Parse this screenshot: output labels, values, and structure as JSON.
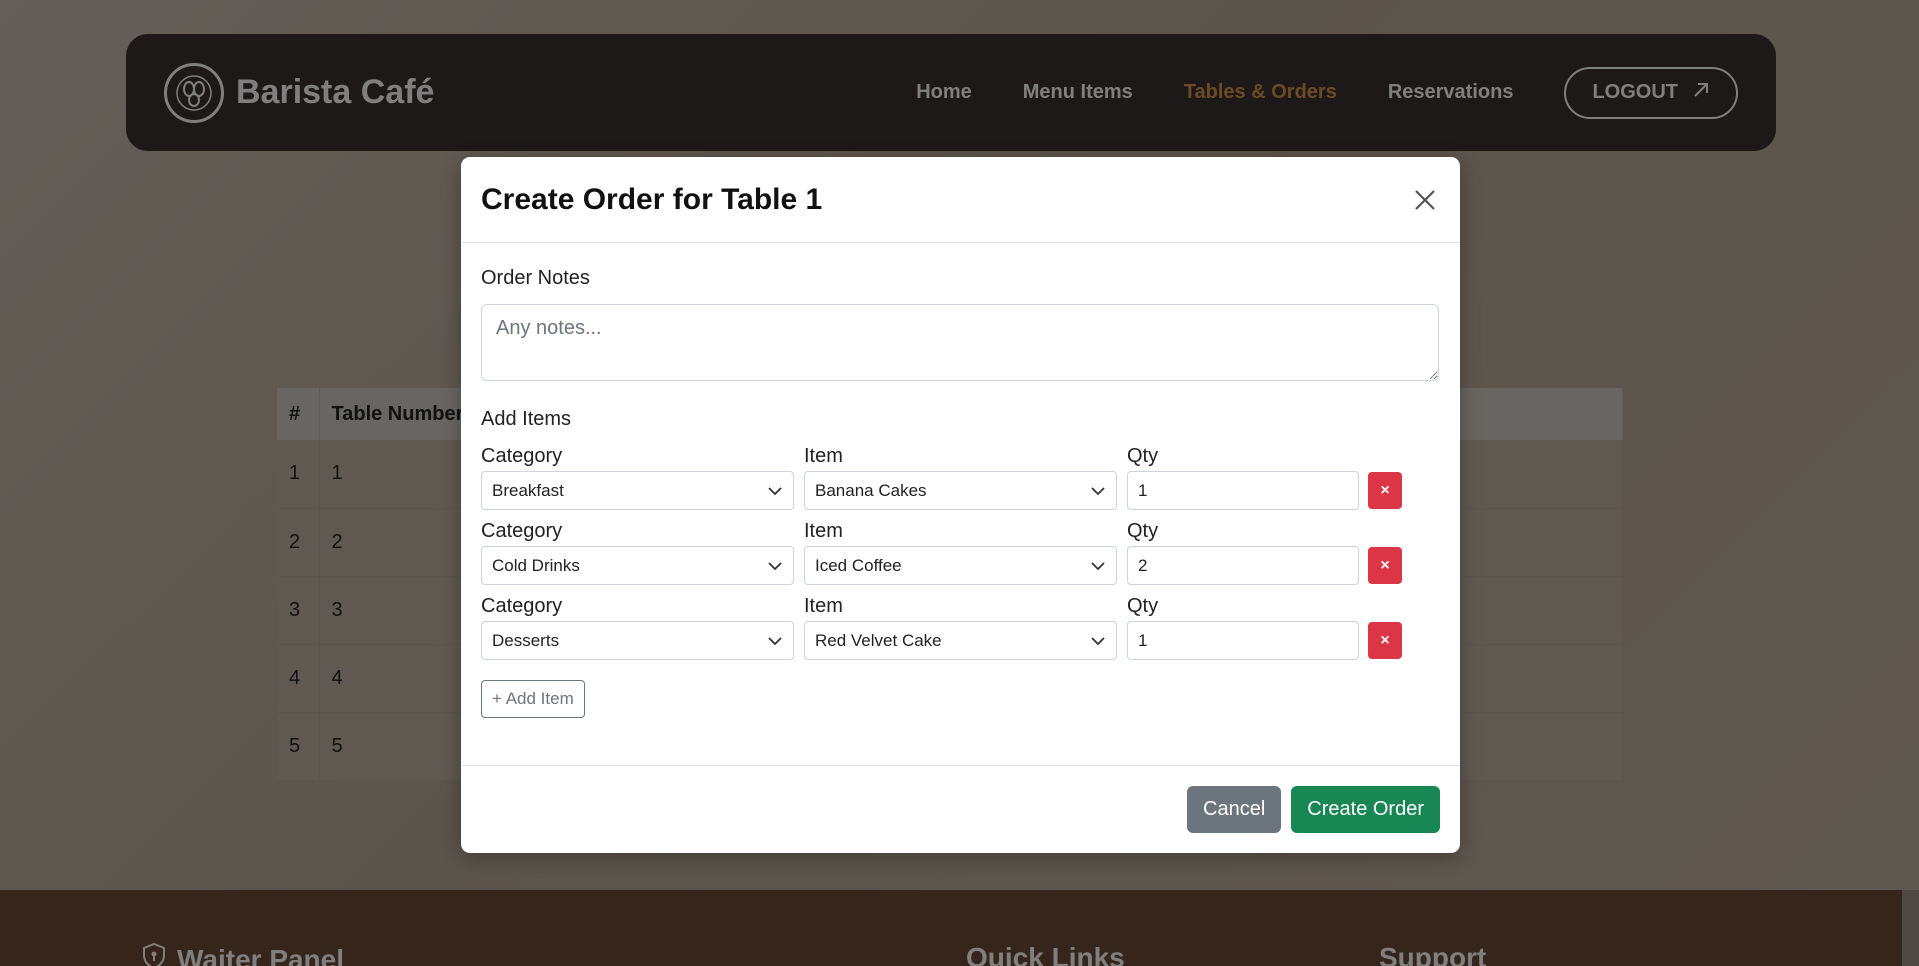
{
  "header": {
    "brand": "Barista Café",
    "nav": [
      {
        "label": "Home",
        "active": false
      },
      {
        "label": "Menu Items",
        "active": false
      },
      {
        "label": "Tables & Orders",
        "active": true
      },
      {
        "label": "Reservations",
        "active": false
      }
    ],
    "logout_label": "LOGOUT"
  },
  "table": {
    "columns": [
      "#",
      "Table Number"
    ],
    "rows": [
      [
        "1",
        "1"
      ],
      [
        "2",
        "2"
      ],
      [
        "3",
        "3"
      ],
      [
        "4",
        "4"
      ],
      [
        "5",
        "5"
      ]
    ]
  },
  "footer": {
    "panel_title": "Waiter Panel",
    "quick_links_title": "Quick Links",
    "support_title": "Support"
  },
  "modal": {
    "title": "Create Order for Table 1",
    "notes_label": "Order Notes",
    "notes_placeholder": "Any notes...",
    "notes_value": "",
    "add_items_label": "Add Items",
    "field_labels": {
      "category": "Category",
      "item": "Item",
      "qty": "Qty"
    },
    "items": [
      {
        "category": "Breakfast",
        "item": "Banana Cakes",
        "qty": "1"
      },
      {
        "category": "Cold Drinks",
        "item": "Iced Coffee",
        "qty": "2"
      },
      {
        "category": "Desserts",
        "item": "Red Velvet Cake",
        "qty": "1"
      }
    ],
    "remove_label": "×",
    "add_item_label": "+ Add Item",
    "cancel_label": "Cancel",
    "create_label": "Create Order"
  },
  "colors": {
    "accent": "#d99548",
    "danger": "#dc3545",
    "success": "#198754",
    "secondary": "#6c757d",
    "navbar": "#3a3330",
    "footer": "#6b4a37"
  }
}
